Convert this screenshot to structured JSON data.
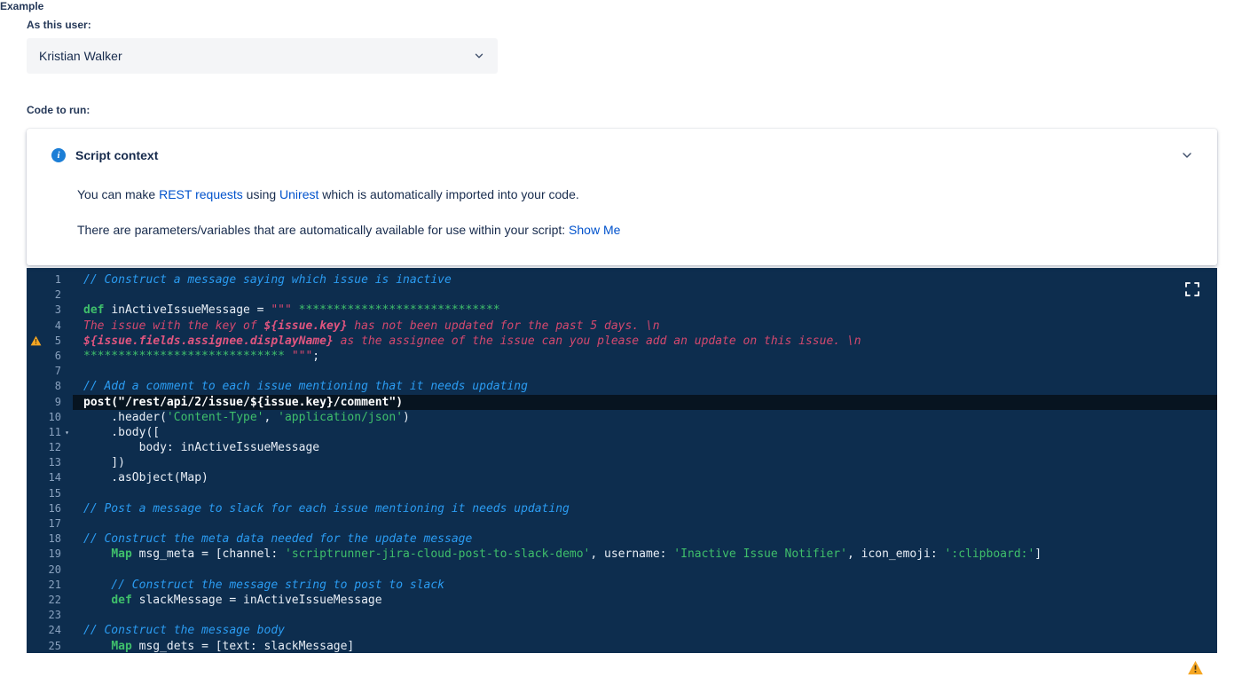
{
  "labels": {
    "as_this_user": "As this user:",
    "code_to_run": "Code to run:",
    "bottom_partial": "Example"
  },
  "user_select": {
    "value": "Kristian Walker"
  },
  "script_context": {
    "title": "Script context",
    "p1_pre": "You can make ",
    "p1_link1": "REST requests",
    "p1_mid": " using ",
    "p1_link2": "Unirest",
    "p1_post": " which is automatically imported into your code.",
    "p2_pre": "There are parameters/variables that are automatically available for use within your script: ",
    "p2_link": "Show Me"
  },
  "editor": {
    "warning_line": 5,
    "fold_line": 11,
    "active_line": 9,
    "lines": [
      {
        "n": 1,
        "seg": [
          [
            "c",
            "// Construct a message saying which issue is inactive"
          ]
        ]
      },
      {
        "n": 2,
        "seg": []
      },
      {
        "n": 3,
        "seg": [
          [
            "k",
            "def "
          ],
          [
            "p",
            "inActiveIssueMessage = "
          ],
          [
            "r",
            "\"\"\" "
          ],
          [
            "s",
            "*****************************"
          ]
        ]
      },
      {
        "n": 4,
        "seg": [
          [
            "r",
            "The issue with the key of "
          ],
          [
            "ri",
            "${issue.key}"
          ],
          [
            "r",
            " has not been updated for the past 5 days. \\n"
          ]
        ]
      },
      {
        "n": 5,
        "warn": true,
        "seg": [
          [
            "ri",
            "${issue.fields.assignee.displayName}"
          ],
          [
            "r",
            " as the assignee of the issue can you please add an update on this issue. \\n"
          ]
        ]
      },
      {
        "n": 6,
        "seg": [
          [
            "s",
            "***************************** "
          ],
          [
            "r",
            "\"\"\""
          ],
          [
            "p",
            ";"
          ]
        ]
      },
      {
        "n": 7,
        "seg": []
      },
      {
        "n": 8,
        "seg": [
          [
            "c",
            "// Add a comment to each issue mentioning that it needs updating"
          ]
        ]
      },
      {
        "n": 9,
        "hl": true,
        "seg": [
          [
            "p",
            "post(\"/rest/api/2/issue/${issue.key}/comment\")"
          ]
        ]
      },
      {
        "n": 10,
        "seg": [
          [
            "p",
            "    .header("
          ],
          [
            "s",
            "'Content-Type'"
          ],
          [
            "p",
            ", "
          ],
          [
            "s",
            "'application/json'"
          ],
          [
            "p",
            ")"
          ]
        ]
      },
      {
        "n": 11,
        "fold": true,
        "seg": [
          [
            "p",
            "    .body(["
          ]
        ]
      },
      {
        "n": 12,
        "seg": [
          [
            "p",
            "        body: inActiveIssueMessage"
          ]
        ]
      },
      {
        "n": 13,
        "seg": [
          [
            "p",
            "    ])"
          ]
        ]
      },
      {
        "n": 14,
        "seg": [
          [
            "p",
            "    .asObject(Map)"
          ]
        ]
      },
      {
        "n": 15,
        "seg": []
      },
      {
        "n": 16,
        "seg": [
          [
            "c",
            "// Post a message to slack for each issue mentioning it needs updating"
          ]
        ]
      },
      {
        "n": 17,
        "seg": []
      },
      {
        "n": 18,
        "seg": [
          [
            "c",
            "// Construct the meta data needed for the update message"
          ]
        ]
      },
      {
        "n": 19,
        "seg": [
          [
            "p",
            "    "
          ],
          [
            "k",
            "Map "
          ],
          [
            "p",
            "msg_meta = [channel: "
          ],
          [
            "s",
            "'scriptrunner-jira-cloud-post-to-slack-demo'"
          ],
          [
            "p",
            ", username: "
          ],
          [
            "s",
            "'Inactive Issue Notifier'"
          ],
          [
            "p",
            ", icon_emoji: "
          ],
          [
            "s",
            "':clipboard:'"
          ],
          [
            "p",
            "]"
          ]
        ]
      },
      {
        "n": 20,
        "seg": []
      },
      {
        "n": 21,
        "seg": [
          [
            "c",
            "    // Construct the message string to post to slack"
          ]
        ]
      },
      {
        "n": 22,
        "seg": [
          [
            "p",
            "    "
          ],
          [
            "k",
            "def "
          ],
          [
            "p",
            "slackMessage = inActiveIssueMessage"
          ]
        ]
      },
      {
        "n": 23,
        "seg": []
      },
      {
        "n": 24,
        "seg": [
          [
            "c",
            "// Construct the message body"
          ]
        ]
      },
      {
        "n": 25,
        "seg": [
          [
            "p",
            "    "
          ],
          [
            "k",
            "Map "
          ],
          [
            "p",
            "msg_dets = [text: slackMessage]"
          ]
        ]
      }
    ]
  },
  "colors": {
    "link": "#0052cc",
    "editor_background": "#0d2d4e",
    "active_line_background": "#071420",
    "comment": "#2b9cf2",
    "keyword_string_green": "#3fbf6b",
    "string_content_red": "#d4486e",
    "warning": "#f5a623",
    "info_icon": "#1c7ed6"
  }
}
